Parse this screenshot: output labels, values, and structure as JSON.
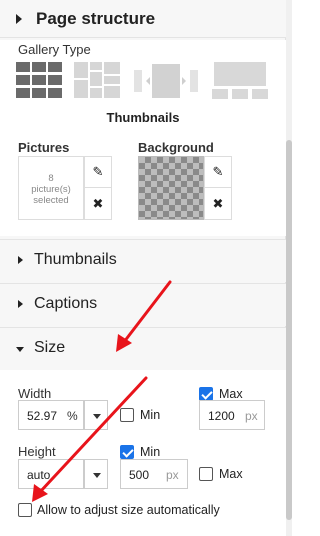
{
  "header": {
    "title": "Page structure"
  },
  "gallery": {
    "type_label": "Gallery Type",
    "types": [
      "grid-gallery-icon",
      "masonry-gallery-icon",
      "slider-gallery-icon",
      "slideshow-gallery-icon"
    ],
    "selected_type": "Thumbnails"
  },
  "pictures": {
    "label": "Pictures",
    "count_line1": "8",
    "count_line2": "picture(s)",
    "count_line3": "selected"
  },
  "background": {
    "label": "Background"
  },
  "sections": {
    "thumbnails": "Thumbnails",
    "captions": "Captions",
    "size": "Size"
  },
  "size": {
    "width_label": "Width",
    "width_value": "52.97",
    "width_unit": "%",
    "min_label": "Min",
    "min_checked": false,
    "max_label": "Max",
    "max_checked": true,
    "max_value": "1200",
    "max_unit": "px",
    "height_label": "Height",
    "height_value": "auto",
    "height_min_label": "Min",
    "height_min_checked": true,
    "height_min_value": "500",
    "height_min_unit": "px",
    "height_max_label": "Max",
    "height_max_checked": false,
    "auto_adjust_label": "Allow to adjust size automatically",
    "auto_adjust_checked": false
  },
  "colors": {
    "accent": "#1a73e8",
    "annotation": "#e8141b"
  }
}
